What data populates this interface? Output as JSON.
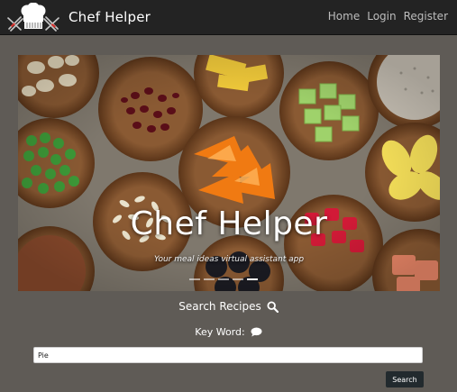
{
  "navbar": {
    "brand_name": "Chef Helper",
    "links": [
      {
        "label": "Home"
      },
      {
        "label": "Login"
      },
      {
        "label": "Register"
      }
    ]
  },
  "carousel": {
    "title": "Chef Helper",
    "subtitle": "Your meal ideas virtual assistant app",
    "indicator_count": 5,
    "active_indicator": 5
  },
  "search": {
    "heading": "Search Recipes",
    "heading_icon": "search-icon",
    "keyword_label": "Key Word:",
    "keyword_icon": "comment-icon",
    "input_value": "Pie",
    "button_label": "Search"
  },
  "colors": {
    "navbar_bg": "#232323",
    "page_bg": "#5f5b56",
    "button_bg": "#222a2e"
  }
}
